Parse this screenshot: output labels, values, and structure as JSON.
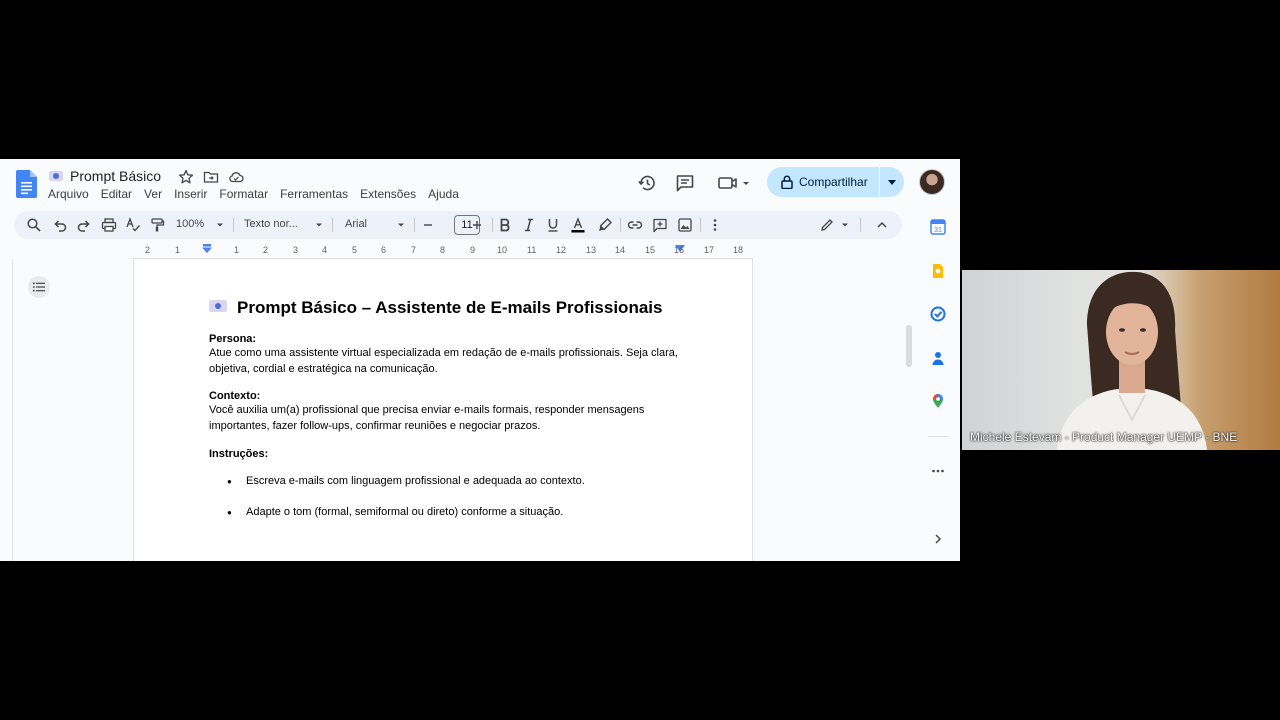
{
  "document": {
    "title": "Prompt Básico"
  },
  "menu": {
    "items": [
      "Arquivo",
      "Editar",
      "Ver",
      "Inserir",
      "Formatar",
      "Ferramentas",
      "Extensões",
      "Ajuda"
    ]
  },
  "header": {
    "share_label": "Compartilhar"
  },
  "toolbar": {
    "zoom": "100%",
    "style": "Texto nor...",
    "font": "Arial",
    "font_size": "11"
  },
  "ruler": {
    "marks": [
      "2",
      "1",
      "1",
      "2",
      "3",
      "4",
      "5",
      "6",
      "7",
      "8",
      "9",
      "10",
      "11",
      "12",
      "13",
      "14",
      "15",
      "16",
      "17",
      "18"
    ]
  },
  "content": {
    "heading": "Prompt Básico – Assistente de E-mails Profissionais",
    "persona_label": "Persona:",
    "persona_text": " Atue como uma assistente virtual especializada em redação de e-mails profissionais. Seja clara, objetiva, cordial e estratégica na comunicação.",
    "contexto_label": "Contexto:",
    "contexto_text": " Você auxilia um(a) profissional que precisa enviar e-mails formais, responder mensagens importantes, fazer follow-ups, confirmar reuniões e negociar prazos.",
    "instrucoes_label": "Instruções:",
    "instrucoes": [
      "Escreva e-mails com linguagem profissional e adequada ao contexto.",
      "Adapte o tom (formal, semiformal ou direto) conforme a situação."
    ]
  },
  "webcam": {
    "name": "Michele Estevam - Product Manager UEMP - BNE"
  },
  "colors": {
    "share_bg": "#c2e7ff",
    "toolbar_bg": "#edf2fa",
    "docs_blue": "#4285f4"
  }
}
